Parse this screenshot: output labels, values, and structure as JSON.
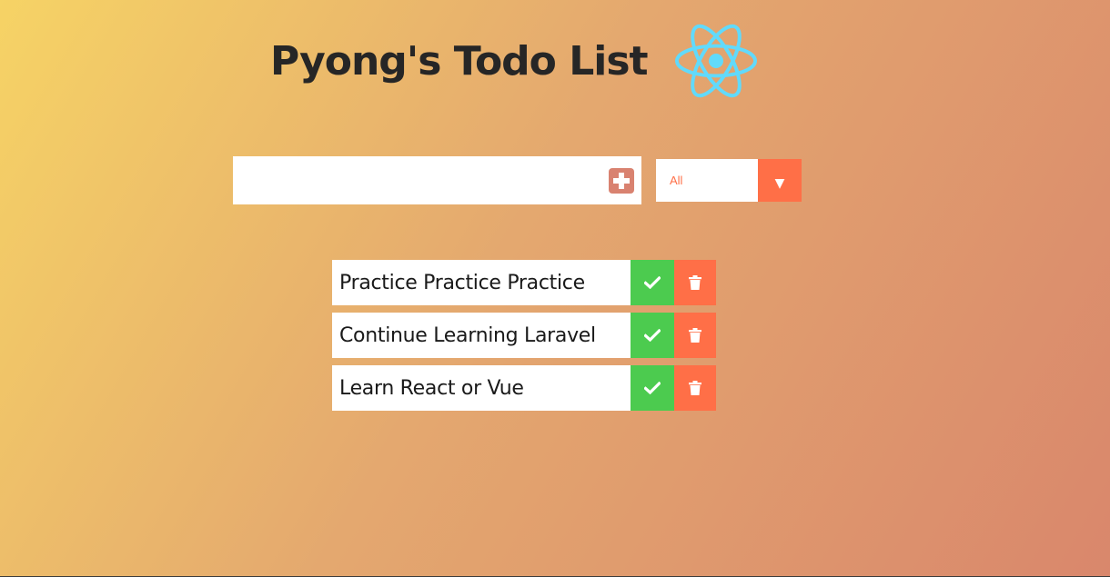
{
  "header": {
    "title": "Pyong's Todo List",
    "logo_icon": "react-logo-icon",
    "logo_color": "#61dafb"
  },
  "form": {
    "input_value": "",
    "add_icon": "plus-icon",
    "filter": {
      "selected": "All",
      "arrow_icon": "caret-down-icon"
    }
  },
  "colors": {
    "complete": "#4ccb4f",
    "trash": "#ff6f47",
    "add_button": "#d98270"
  },
  "todos": [
    {
      "text": "Practice Practice Practice",
      "complete_icon": "check-icon",
      "delete_icon": "trash-icon"
    },
    {
      "text": "Continue Learning Laravel",
      "complete_icon": "check-icon",
      "delete_icon": "trash-icon"
    },
    {
      "text": "Learn React or Vue",
      "complete_icon": "check-icon",
      "delete_icon": "trash-icon"
    }
  ]
}
